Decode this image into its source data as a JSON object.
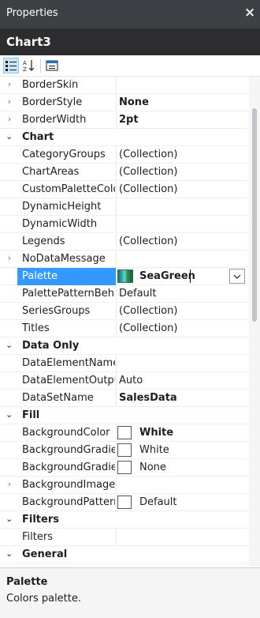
{
  "window": {
    "title": "Properties",
    "close_glyph": "×"
  },
  "object": {
    "name": "Chart3"
  },
  "toolbar": {
    "categorized_icon": "categorized-icon",
    "alphabetical_icon": "alphabetical-icon",
    "property_pages_icon": "property-pages-icon"
  },
  "colors": {
    "selection": "#3399ff",
    "title_bg": "#3f3f46",
    "object_bg": "#2d2d30"
  },
  "grid": {
    "rows": [
      {
        "kind": "prop",
        "expander": "›",
        "name": "BorderSkin",
        "value": ""
      },
      {
        "kind": "prop",
        "expander": "›",
        "name": "BorderStyle",
        "value": "None",
        "bold": true
      },
      {
        "kind": "prop",
        "expander": "›",
        "name": "BorderWidth",
        "value": "2pt",
        "bold": true
      },
      {
        "kind": "cat",
        "caret": "⌄",
        "name": "Chart"
      },
      {
        "kind": "prop",
        "name": "CategoryGroups",
        "value": "(Collection)"
      },
      {
        "kind": "prop",
        "name": "ChartAreas",
        "value": "(Collection)"
      },
      {
        "kind": "prop",
        "name": "CustomPaletteColo",
        "value": "(Collection)"
      },
      {
        "kind": "prop",
        "name": "DynamicHeight",
        "value": ""
      },
      {
        "kind": "prop",
        "name": "DynamicWidth",
        "value": ""
      },
      {
        "kind": "prop",
        "name": "Legends",
        "value": "(Collection)"
      },
      {
        "kind": "prop",
        "expander": "›",
        "name": "NoDataMessage",
        "value": ""
      },
      {
        "kind": "palette",
        "name": "Palette",
        "value": "SeaGreen"
      },
      {
        "kind": "prop",
        "name": "PalettePatternBeha",
        "value": "Default"
      },
      {
        "kind": "prop",
        "name": "SeriesGroups",
        "value": "(Collection)"
      },
      {
        "kind": "prop",
        "name": "Titles",
        "value": "(Collection)"
      },
      {
        "kind": "cat",
        "caret": "⌄",
        "name": "Data Only"
      },
      {
        "kind": "prop",
        "name": "DataElementName",
        "value": ""
      },
      {
        "kind": "prop",
        "name": "DataElementOutpu",
        "value": "Auto"
      },
      {
        "kind": "prop",
        "name": "DataSetName",
        "value": "SalesData",
        "bold": true
      },
      {
        "kind": "cat",
        "caret": "⌄",
        "name": "Fill"
      },
      {
        "kind": "swatch",
        "name": "BackgroundColor",
        "value": "White",
        "bold": true
      },
      {
        "kind": "swatch",
        "name": "BackgroundGradier",
        "value": "White"
      },
      {
        "kind": "swatch",
        "name": "BackgroundGradier",
        "value": "None"
      },
      {
        "kind": "prop",
        "expander": "›",
        "name": "BackgroundImage",
        "value": ""
      },
      {
        "kind": "swatch",
        "name": "BackgroundPattern",
        "value": "Default"
      },
      {
        "kind": "cat",
        "caret": "⌄",
        "name": "Filters"
      },
      {
        "kind": "prop",
        "name": "Filters",
        "value": ""
      },
      {
        "kind": "cat",
        "caret": "⌄",
        "name": "General"
      }
    ]
  },
  "description": {
    "title": "Palette",
    "text": "Colors palette."
  }
}
